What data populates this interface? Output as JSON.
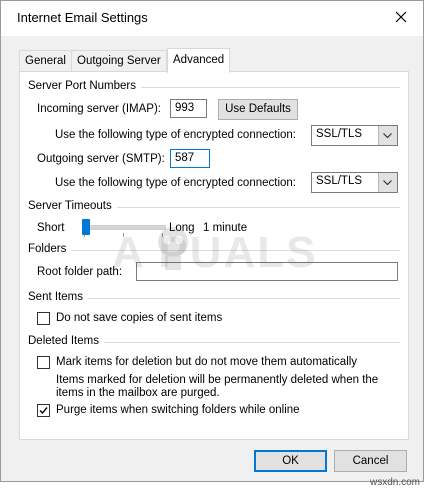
{
  "window": {
    "title": "Internet Email Settings"
  },
  "tabs": [
    {
      "label": "General",
      "active": false
    },
    {
      "label": "Outgoing Server",
      "active": false
    },
    {
      "label": "Advanced",
      "active": true
    }
  ],
  "server_ports": {
    "heading": "Server Port Numbers",
    "incoming_label": "Incoming server (IMAP):",
    "incoming_value": "993",
    "use_defaults_label": "Use Defaults",
    "encryption_label": "Use the following type of encrypted connection:",
    "incoming_encryption": "SSL/TLS",
    "outgoing_label": "Outgoing server (SMTP):",
    "outgoing_value": "587",
    "outgoing_encryption": "SSL/TLS"
  },
  "timeouts": {
    "heading": "Server Timeouts",
    "short_label": "Short",
    "long_label": "Long",
    "value_label": "1 minute",
    "slider_fraction": 0.0
  },
  "folders": {
    "heading": "Folders",
    "root_label": "Root folder path:",
    "root_value": ""
  },
  "sent_items": {
    "heading": "Sent Items",
    "dont_save_label": "Do not save copies of sent items",
    "dont_save_checked": false
  },
  "deleted_items": {
    "heading": "Deleted Items",
    "mark_label": "Mark items for deletion but do not move them automatically",
    "mark_checked": false,
    "note_line1": "Items marked for deletion will be permanently deleted when the",
    "note_line2": "items in the mailbox are purged.",
    "purge_label": "Purge items when switching folders while online",
    "purge_checked": true
  },
  "buttons": {
    "ok": "OK",
    "cancel": "Cancel"
  },
  "watermark": {
    "text": "A  PUALS",
    "site": "wsxdn.com"
  },
  "colors": {
    "accent": "#0078d7",
    "dialog_bg": "#f0f0f0"
  }
}
